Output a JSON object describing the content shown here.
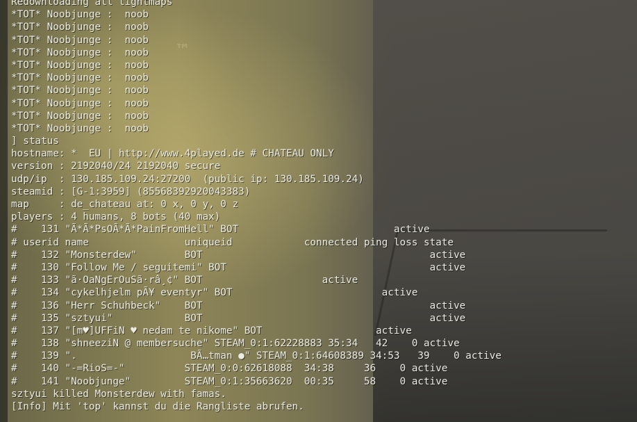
{
  "background": {
    "watermark": "™"
  },
  "console_lines": [
    "Redownloading all lightmaps",
    "*TOT* Noobjunge :  noob",
    "*TOT* Noobjunge :  noob",
    "*TOT* Noobjunge :  noob",
    "*TOT* Noobjunge :  noob",
    "*TOT* Noobjunge :  noob",
    "*TOT* Noobjunge :  noob",
    "*TOT* Noobjunge :  noob",
    "*TOT* Noobjunge :  noob",
    "*TOT* Noobjunge :  noob",
    "*TOT* Noobjunge :  noob",
    "] status",
    "hostname: *  EU | http://www.4played.de # CHATEAU ONLY",
    "version : 2192040/24 2192040 secure",
    "udp/ip  : 130.185.109.24:27200  (public ip: 130.185.109.24)",
    "steamid : [G-1:3959] (85568392920043383)",
    "map     : de_chateau at: 0 x, 0 y, 0 z",
    "players : 4 humans, 8 bots (40 max)",
    "#    131 \"Ã*Ã*PsOÃ*Ã*PainFromHell\" BOT                          active",
    "# userid name                uniqueid            connected ping loss state",
    "#    132 \"Monsterdew\"        BOT                                      active",
    "#    130 \"Follow Me / seguitemi\" BOT                                  active",
    "#    133 \"ã·OaNgErOuSã·râ¸¢\" BOT                    active",
    "#    134 \"cykelhjelm pÃ¥ eventyr\" BOT                         active",
    "#    136 \"Herr Schuhbeck\"    BOT                                      active",
    "#    135 \"sztyui\"            BOT                                      active",
    "#    137 \"[m♥]UFFiN ♥ nedam te nikome\" BOT                   active",
    "#    138 \"shneeziN @ membersuche\" STEAM_0:1:62228883 35:34   42    0 active",
    "#    139 \".                   BÃ…tman ●\" STEAM_0:1:64608389 34:53   39    0 active",
    "#    140 \"-=RioS=-\"          STEAM_0:0:62618088  34:38     36    0 active",
    "#    141 \"Noobjunge\"         STEAM_0:1:35663620  00:35     58    0 active",
    "sztyui killed Monsterdew with famas.",
    "[Info] Mit 'top' kannst du die Rangliste abrufen."
  ]
}
